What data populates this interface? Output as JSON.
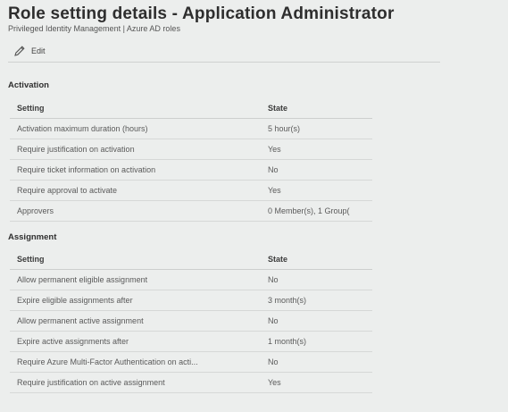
{
  "header": {
    "title": "Role setting details - Application Administrator",
    "breadcrumb": "Privileged Identity Management | Azure AD roles"
  },
  "toolbar": {
    "edit_label": "Edit",
    "edit_icon": "pencil-icon"
  },
  "activation": {
    "section_title": "Activation",
    "col_setting": "Setting",
    "col_state": "State",
    "rows": [
      {
        "setting": "Activation maximum duration (hours)",
        "state": "5 hour(s)"
      },
      {
        "setting": "Require justification on activation",
        "state": "Yes"
      },
      {
        "setting": "Require ticket information on activation",
        "state": "No"
      },
      {
        "setting": "Require approval to activate",
        "state": "Yes"
      },
      {
        "setting": "Approvers",
        "state": "0 Member(s), 1 Group("
      }
    ]
  },
  "assignment": {
    "section_title": "Assignment",
    "col_setting": "Setting",
    "col_state": "State",
    "rows": [
      {
        "setting": "Allow permanent eligible assignment",
        "state": "No"
      },
      {
        "setting": "Expire eligible assignments after",
        "state": "3 month(s)"
      },
      {
        "setting": "Allow permanent active assignment",
        "state": "No"
      },
      {
        "setting": "Expire active assignments after",
        "state": "1 month(s)"
      },
      {
        "setting": "Require Azure Multi-Factor Authentication on acti...",
        "state": "No"
      },
      {
        "setting": "Require justification on active assignment",
        "state": "Yes"
      }
    ]
  }
}
